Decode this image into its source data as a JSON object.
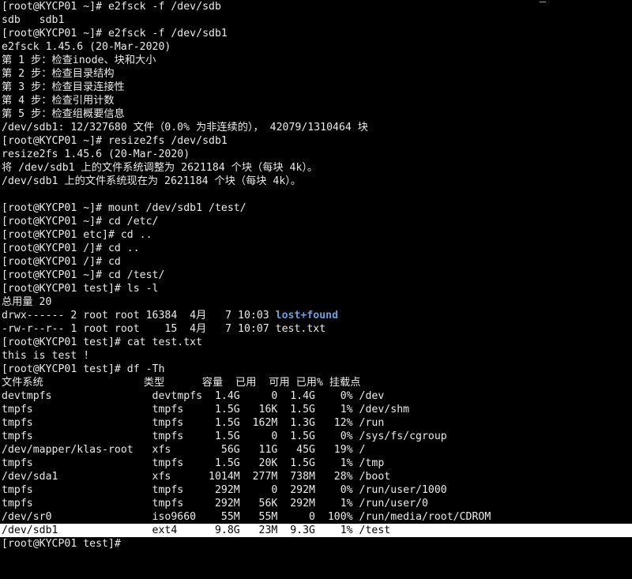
{
  "terminal": {
    "lines": [
      "[root@KYCP01 ~]# e2fsck -f /dev/sdb",
      "sdb   sdb1",
      "[root@KYCP01 ~]# e2fsck -f /dev/sdb1",
      "e2fsck 1.45.6 (20-Mar-2020)",
      "第 1 步：检查inode、块和大小",
      "第 2 步：检查目录结构",
      "第 3 步：检查目录连接性",
      "第 4 步：检查引用计数",
      "第 5 步：检查组概要信息",
      "/dev/sdb1: 12/327680 文件（0.0% 为非连续的）， 42079/1310464 块",
      "[root@KYCP01 ~]# resize2fs /dev/sdb1",
      "resize2fs 1.45.6 (20-Mar-2020)",
      "将 /dev/sdb1 上的文件系统调整为 2621184 个块（每块 4k）。",
      "/dev/sdb1 上的文件系统现在为 2621184 个块（每块 4k）。",
      "",
      "[root@KYCP01 ~]# mount /dev/sdb1 /test/",
      "[root@KYCP01 ~]# cd /etc/",
      "[root@KYCP01 etc]# cd ..",
      "[root@KYCP01 /]# cd ..",
      "[root@KYCP01 /]# cd",
      "[root@KYCP01 ~]# cd /test/",
      "[root@KYCP01 test]# ls -l",
      "总用量 20"
    ],
    "ls_entries": [
      {
        "prefix": "drwx------ 2 root root 16384  4月   7 10:03 ",
        "name": "lost+found"
      },
      {
        "prefix": "-rw-r--r-- 1 root root    15  4月   7 10:07 ",
        "name": "test.txt"
      }
    ],
    "lines_after_ls": [
      "[root@KYCP01 test]# cat test.txt",
      "this is test !",
      "[root@KYCP01 test]# df -Th"
    ],
    "df_header": "文件系统                类型      容量  已用  可用 已用% 挂载点",
    "df_rows": [
      "devtmpfs                devtmpfs  1.4G     0  1.4G    0% /dev",
      "tmpfs                   tmpfs     1.5G   16K  1.5G    1% /dev/shm",
      "tmpfs                   tmpfs     1.5G  162M  1.3G   12% /run",
      "tmpfs                   tmpfs     1.5G     0  1.5G    0% /sys/fs/cgroup",
      "/dev/mapper/klas-root   xfs        56G   11G   45G   19% /",
      "tmpfs                   tmpfs     1.5G   20K  1.5G    1% /tmp",
      "/dev/sda1               xfs      1014M  277M  738M   28% /boot",
      "tmpfs                   tmpfs     292M     0  292M    0% /run/user/1000",
      "tmpfs                   tmpfs     292M   56K  292M    1% /run/user/0",
      "/dev/sr0                iso9660    55M   55M     0  100% /run/media/root/CDROM"
    ],
    "df_selected_row": "/dev/sdb1               ext4      9.8G   23M  9.3G    1% /test",
    "final_prompt": "[root@KYCP01 test]# "
  },
  "colors": {
    "background": "#000000",
    "foreground": "#eaeaea",
    "directory": "#6f9fd8",
    "selection_bg": "#ffffff",
    "selection_fg": "#000000"
  }
}
